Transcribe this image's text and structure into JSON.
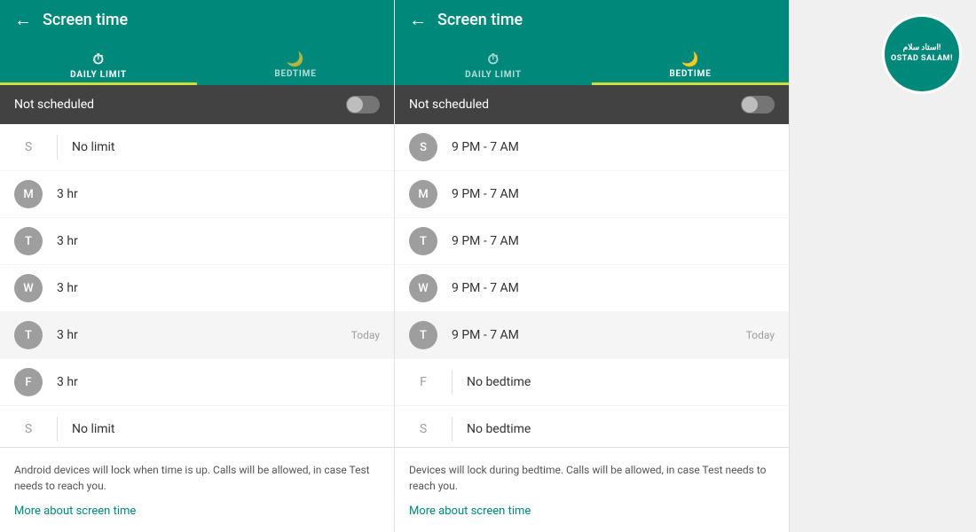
{
  "left_panel": {
    "header": {
      "back_icon": "←",
      "title": "Screen time"
    },
    "tabs": [
      {
        "id": "daily",
        "icon": "⏱",
        "label": "DAILY LIMIT",
        "active": true
      },
      {
        "id": "bedtime",
        "icon": "🌙",
        "label": "BEDTIME",
        "active": false
      }
    ],
    "schedule_bar": {
      "text": "Not scheduled",
      "toggle_state": "off"
    },
    "days": [
      {
        "letter": "S",
        "style": "empty",
        "value": "No limit",
        "today": false
      },
      {
        "letter": "M",
        "style": "circle",
        "value": "3 hr",
        "today": false
      },
      {
        "letter": "T",
        "style": "circle",
        "value": "3 hr",
        "today": false
      },
      {
        "letter": "W",
        "style": "circle",
        "value": "3 hr",
        "today": false
      },
      {
        "letter": "T",
        "style": "circle",
        "value": "3 hr",
        "today": true,
        "today_label": "Today"
      },
      {
        "letter": "F",
        "style": "circle",
        "value": "3 hr",
        "today": false
      },
      {
        "letter": "S",
        "style": "empty",
        "value": "No limit",
        "today": false
      }
    ],
    "footer": {
      "text": "Android devices will lock when time is up. Calls will be allowed, in case Test needs to reach you.",
      "link": "More about screen time"
    }
  },
  "right_panel": {
    "header": {
      "back_icon": "←",
      "title": "Screen time"
    },
    "tabs": [
      {
        "id": "daily",
        "icon": "⏱",
        "label": "DAILY LIMIT",
        "active": false
      },
      {
        "id": "bedtime",
        "icon": "🌙",
        "label": "BEDTIME",
        "active": true
      }
    ],
    "schedule_bar": {
      "text": "Not scheduled",
      "toggle_state": "off"
    },
    "days": [
      {
        "letter": "S",
        "style": "circle",
        "value": "9 PM - 7 AM",
        "today": false
      },
      {
        "letter": "M",
        "style": "circle",
        "value": "9 PM - 7 AM",
        "today": false
      },
      {
        "letter": "T",
        "style": "circle",
        "value": "9 PM - 7 AM",
        "today": false
      },
      {
        "letter": "W",
        "style": "circle",
        "value": "9 PM - 7 AM",
        "today": false
      },
      {
        "letter": "T",
        "style": "circle",
        "value": "9 PM - 7 AM",
        "today": true,
        "today_label": "Today"
      },
      {
        "letter": "F",
        "style": "empty",
        "value": "No bedtime",
        "today": false
      },
      {
        "letter": "S",
        "style": "empty",
        "value": "No bedtime",
        "today": false
      }
    ],
    "footer": {
      "text": "Devices will lock during bedtime. Calls will be allowed, in case Test needs to reach you.",
      "link": "More about screen time"
    }
  },
  "logo": {
    "line1": "استاد سلام!",
    "line2": "OSTAD SALAM!"
  }
}
